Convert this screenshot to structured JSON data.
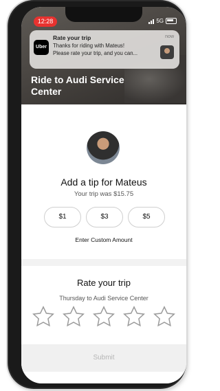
{
  "status_bar": {
    "time": "12:28",
    "network": "5G"
  },
  "notification": {
    "app_logo": "Uber",
    "title": "Rate your trip",
    "line1": "Thanks for riding with Mateus!",
    "line2": "Please rate your trip, and you can...",
    "time": "now"
  },
  "background": {
    "destination_title": "Ride to Audi Service Center"
  },
  "tip": {
    "title": "Add a tip for Mateus",
    "trip_price": "Your trip was $15.75",
    "options": [
      "$1",
      "$3",
      "$5"
    ],
    "custom_label": "Enter Custom Amount"
  },
  "rating": {
    "title": "Rate your trip",
    "subtitle": "Thursday to Audi Service Center",
    "stars": 5,
    "selected": 0,
    "star_icon": "star-outline-icon"
  },
  "submit_label": "Submit",
  "colors": {
    "time_pill": "#e7322f",
    "submit_bg": "#f0f0f0",
    "submit_text": "#b5b5b5"
  }
}
